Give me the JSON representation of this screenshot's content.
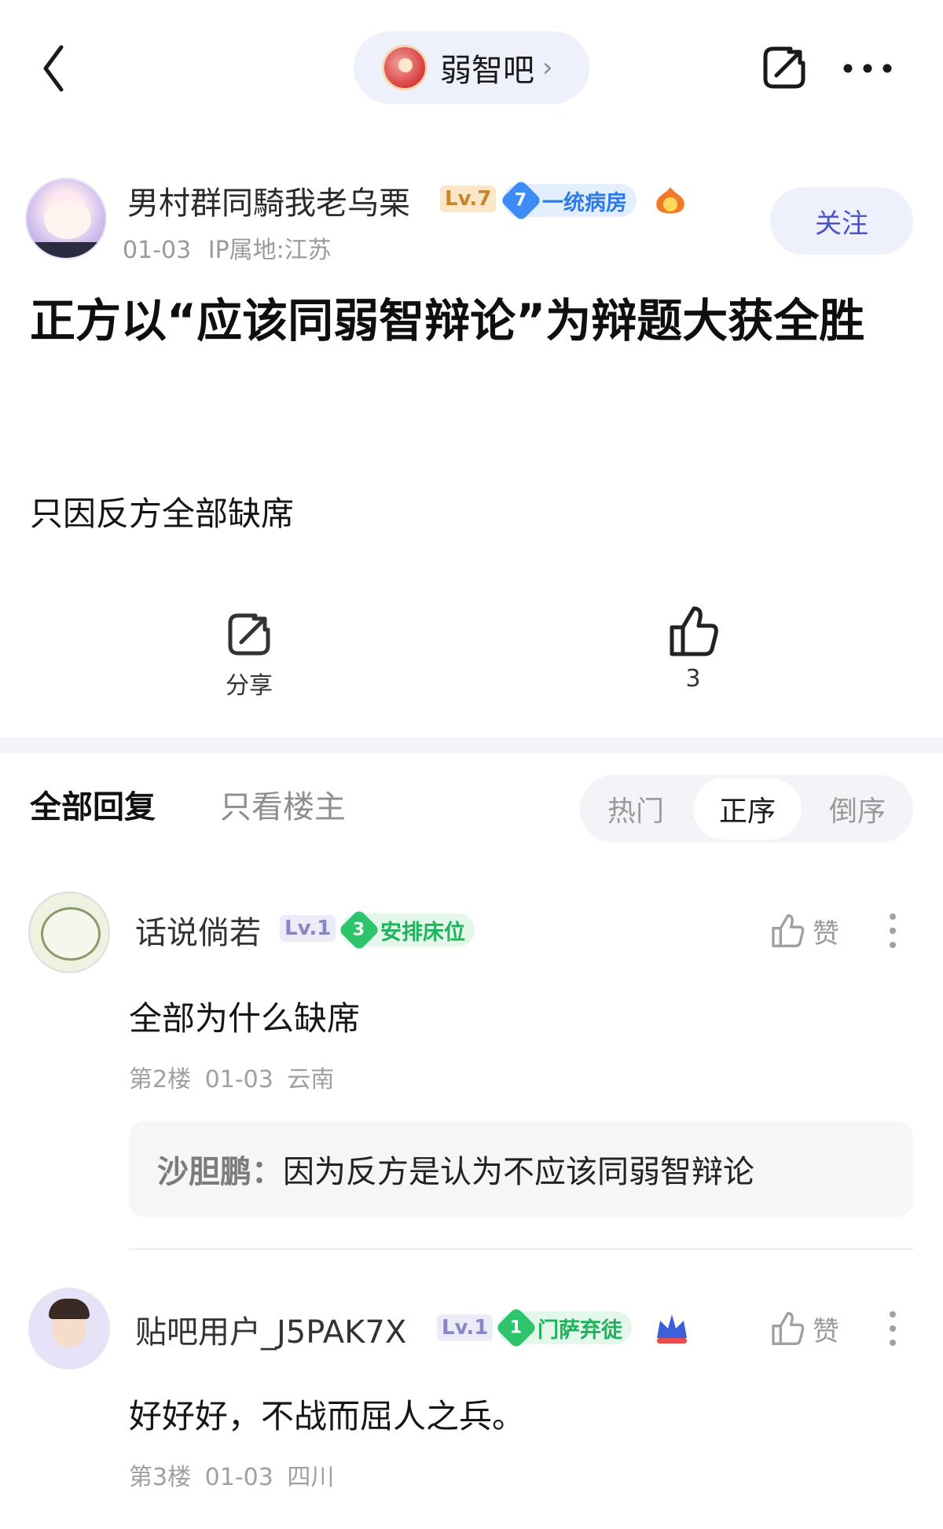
{
  "header": {
    "forum_name": "弱智吧",
    "forum_chevron": "›"
  },
  "post": {
    "author": {
      "name": "男村群同騎我老乌栗",
      "level": "Lv.7",
      "title_level": "7",
      "title": "一统病房"
    },
    "date": "01-03",
    "ip": "IP属地:江苏",
    "follow_label": "关注",
    "title": "正方以“应该同弱智辩论”为辩题大获全胜",
    "body": "只因反方全部缺席",
    "share_label": "分享",
    "like_count": "3"
  },
  "replies_header": {
    "tab_all": "全部回复",
    "tab_op_only": "只看楼主",
    "sort_options": [
      "热门",
      "正序",
      "倒序"
    ],
    "sort_selected": "正序"
  },
  "comments": [
    {
      "name": "话说倘若",
      "level": "Lv.1",
      "title_level": "3",
      "title": "安排床位",
      "like_label": "赞",
      "text": "全部为什么缺席",
      "floor": "第2楼",
      "date": "01-03",
      "location": "云南",
      "sub_reply": {
        "name": "沙胆鹏：",
        "text": "因为反方是认为不应该同弱智辩论"
      }
    },
    {
      "name": "贴吧用户_J5PAK7X",
      "level": "Lv.1",
      "title_level": "1",
      "title": "门萨弃徒",
      "like_label": "赞",
      "text": "好好好，不战而屈人之兵。",
      "floor": "第3楼",
      "date": "01-03",
      "location": "四川"
    }
  ],
  "colors": {
    "accent": "#4a55c9",
    "pill_bg": "#eef0fb",
    "blue_badge": "#2d7be8",
    "green_badge": "#1fb35c",
    "muted": "#9a9a9a"
  },
  "icons": [
    "chevron-left-icon",
    "forum-logo-icon",
    "share-icon",
    "more-icon",
    "flame-badge-icon",
    "thumb-up-icon",
    "crown-badge-icon"
  ]
}
